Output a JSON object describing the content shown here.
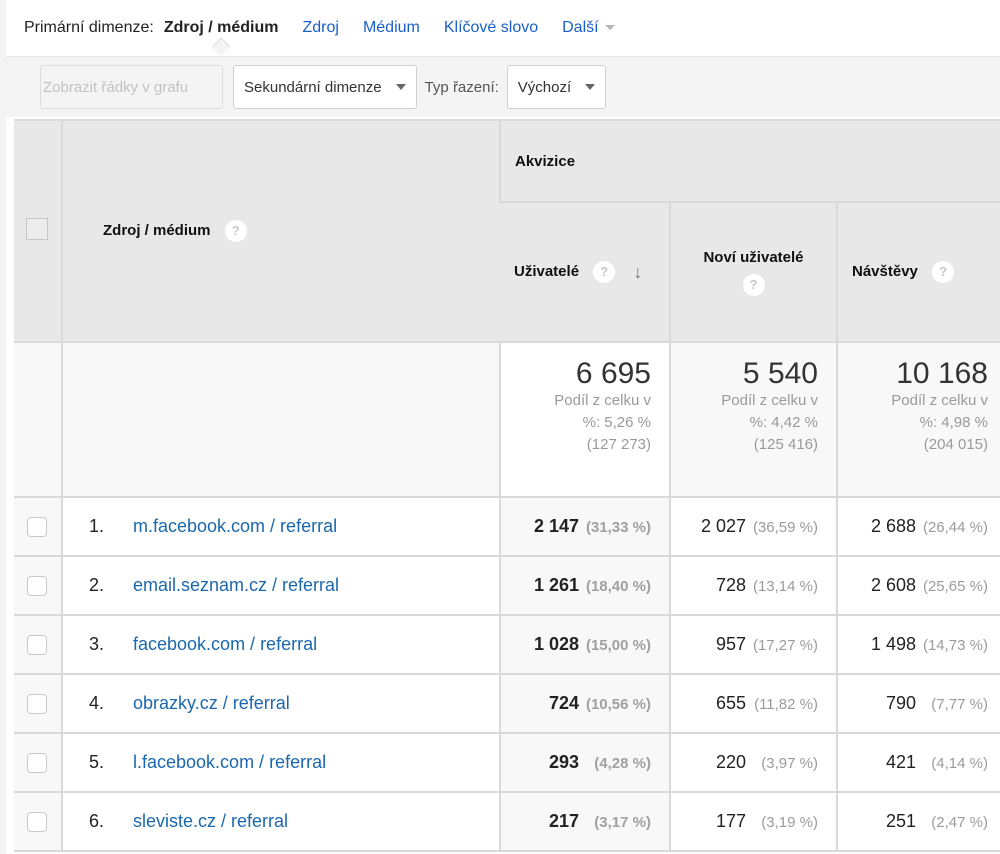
{
  "primary_dimension": {
    "label": "Primární dimenze:",
    "active": "Zdroj / médium",
    "options": [
      "Zdroj",
      "Médium",
      "Klíčové slovo"
    ],
    "more": "Další"
  },
  "toolbar": {
    "plot_rows_label": "Zobrazit řádky v grafu",
    "secondary_dimension_label": "Sekundární dimenze",
    "sort_type_label": "Typ řazení:",
    "sort_type_value": "Výchozí"
  },
  "table": {
    "dimension_header": "Zdroj / médium",
    "group_header": "Akvizice",
    "columns": [
      {
        "key": "users",
        "label": "Uživatelé",
        "sorted": "descending"
      },
      {
        "key": "new_users",
        "label": "Noví uživatelé"
      },
      {
        "key": "visits",
        "label": "Návštěvy"
      }
    ],
    "help_glyph": "?",
    "sort_glyph": "↓",
    "totals": [
      {
        "value": "6 695",
        "share_line1": "Podíl z celku v",
        "share_line2": "%: 5,26 %",
        "share_total": "(127 273)"
      },
      {
        "value": "5 540",
        "share_line1": "Podíl z celku v",
        "share_line2": "%: 4,42 %",
        "share_total": "(125 416)"
      },
      {
        "value": "10 168",
        "share_line1": "Podíl z celku v",
        "share_line2": "%: 4,98 %",
        "share_total": "(204 015)"
      }
    ],
    "rows": [
      {
        "index": "1.",
        "source": "m.facebook.com / referral",
        "users": "2 147",
        "users_pct": "(31,33 %)",
        "new_users": "2 027",
        "new_users_pct": "(36,59 %)",
        "visits": "2 688",
        "visits_pct": "(26,44 %)"
      },
      {
        "index": "2.",
        "source": "email.seznam.cz / referral",
        "users": "1 261",
        "users_pct": "(18,40 %)",
        "new_users": "728",
        "new_users_pct": "(13,14 %)",
        "visits": "2 608",
        "visits_pct": "(25,65 %)"
      },
      {
        "index": "3.",
        "source": "facebook.com / referral",
        "users": "1 028",
        "users_pct": "(15,00 %)",
        "new_users": "957",
        "new_users_pct": "(17,27 %)",
        "visits": "1 498",
        "visits_pct": "(14,73 %)"
      },
      {
        "index": "4.",
        "source": "obrazky.cz / referral",
        "users": "724",
        "users_pct": "(10,56 %)",
        "new_users": "655",
        "new_users_pct": "(11,82 %)",
        "visits": "790",
        "visits_pct": "(7,77 %)"
      },
      {
        "index": "5.",
        "source": "l.facebook.com / referral",
        "users": "293",
        "users_pct": "(4,28 %)",
        "new_users": "220",
        "new_users_pct": "(3,97 %)",
        "visits": "421",
        "visits_pct": "(4,14 %)"
      },
      {
        "index": "6.",
        "source": "sleviste.cz / referral",
        "users": "217",
        "users_pct": "(3,17 %)",
        "new_users": "177",
        "new_users_pct": "(3,19 %)",
        "visits": "251",
        "visits_pct": "(2,47 %)"
      }
    ]
  },
  "colors": {
    "link": "#1b68ad",
    "tab_link": "#1a5fc7",
    "header_bg": "#e8e8e8",
    "toolbar_bg": "#f4f4f4"
  }
}
